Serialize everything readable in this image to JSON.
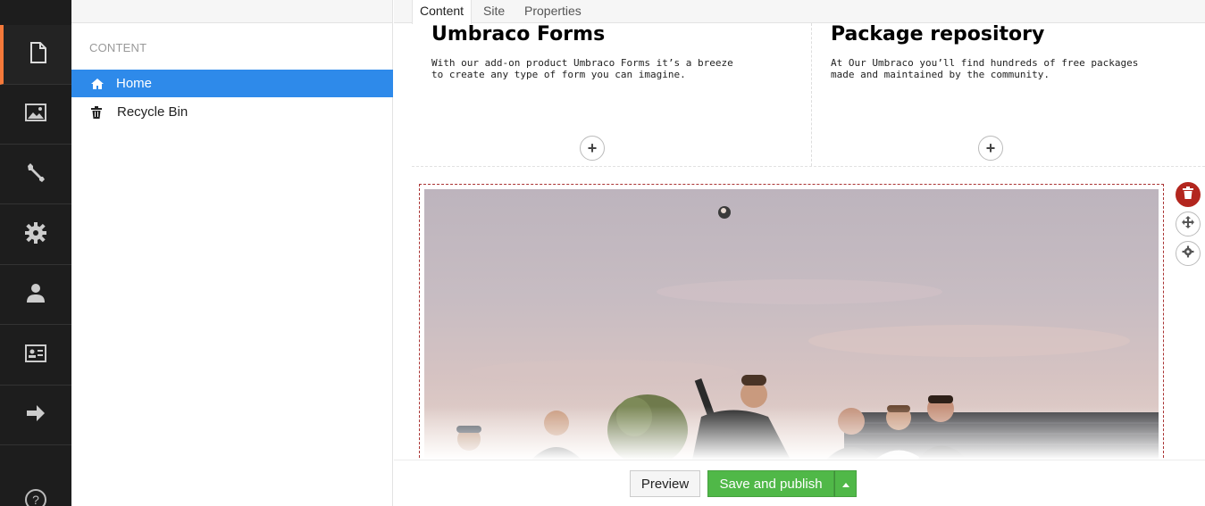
{
  "rail": {
    "items": [
      {
        "icon": "document-icon",
        "active": true
      },
      {
        "icon": "image-icon",
        "active": false
      },
      {
        "icon": "wrench-icon",
        "active": false
      },
      {
        "icon": "gear-icon",
        "active": false
      },
      {
        "icon": "user-icon",
        "active": false
      },
      {
        "icon": "id-card-icon",
        "active": false
      },
      {
        "icon": "arrow-right-icon",
        "active": false
      }
    ],
    "help_icon": "help-icon",
    "accent_color": "#f5793a"
  },
  "tree": {
    "heading": "CONTENT",
    "items": [
      {
        "label": "Home",
        "icon": "home-icon",
        "selected": true
      },
      {
        "label": "Recycle Bin",
        "icon": "trash-icon",
        "selected": false
      }
    ],
    "selected_color": "#2e8aea"
  },
  "tabs": [
    {
      "label": "Content",
      "active": true
    },
    {
      "label": "Site",
      "active": false
    },
    {
      "label": "Properties",
      "active": false
    }
  ],
  "columns": [
    {
      "title": "Umbraco Forms",
      "text": "With our add-on product Umbraco Forms it’s a breeze to create any type of form you can imagine.",
      "add_icon": "plus-icon"
    },
    {
      "title": "Package repository",
      "text": "At Our Umbraco you’ll find hundreds of free packages made and maintained by the community.",
      "add_icon": "plus-icon"
    }
  ],
  "image_tools": [
    {
      "icon": "trash-icon",
      "color": "#b3261e"
    },
    {
      "icon": "move-icon"
    },
    {
      "icon": "gear-icon"
    }
  ],
  "footer": {
    "preview_label": "Preview",
    "publish_label": "Save and publish",
    "publish_color": "#50b848"
  }
}
